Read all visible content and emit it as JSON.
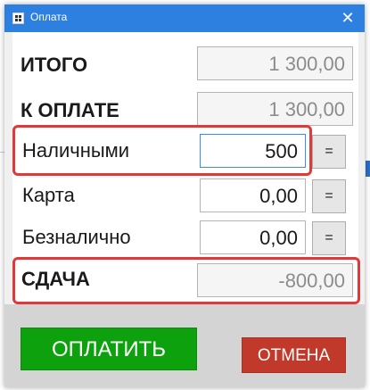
{
  "window": {
    "title": "Оплата",
    "close_glyph": "✕"
  },
  "rows": {
    "total": {
      "label": "ИТОГО",
      "value": "1 300,00"
    },
    "to_pay": {
      "label": "К ОПЛАТЕ",
      "value": "1 300,00"
    },
    "cash": {
      "label": "Наличными",
      "value": "500",
      "eq_label": "="
    },
    "card": {
      "label": "Карта",
      "value": "0,00",
      "eq_label": "="
    },
    "cashless": {
      "label": "Безналично",
      "value": "0,00",
      "eq_label": "="
    },
    "change": {
      "label": "СДАЧА",
      "value": "-800,00"
    }
  },
  "buttons": {
    "pay_label": "ОПЛАТИТЬ",
    "cancel_label": "ОТМЕНА"
  },
  "colors": {
    "titlebar": "#2d7fe0",
    "pay_button": "#0da10d",
    "cancel_button": "#c0392b",
    "highlight": "#e0393a"
  },
  "icons": {
    "title_icon": "app-icon",
    "close_icon": "close-icon"
  }
}
